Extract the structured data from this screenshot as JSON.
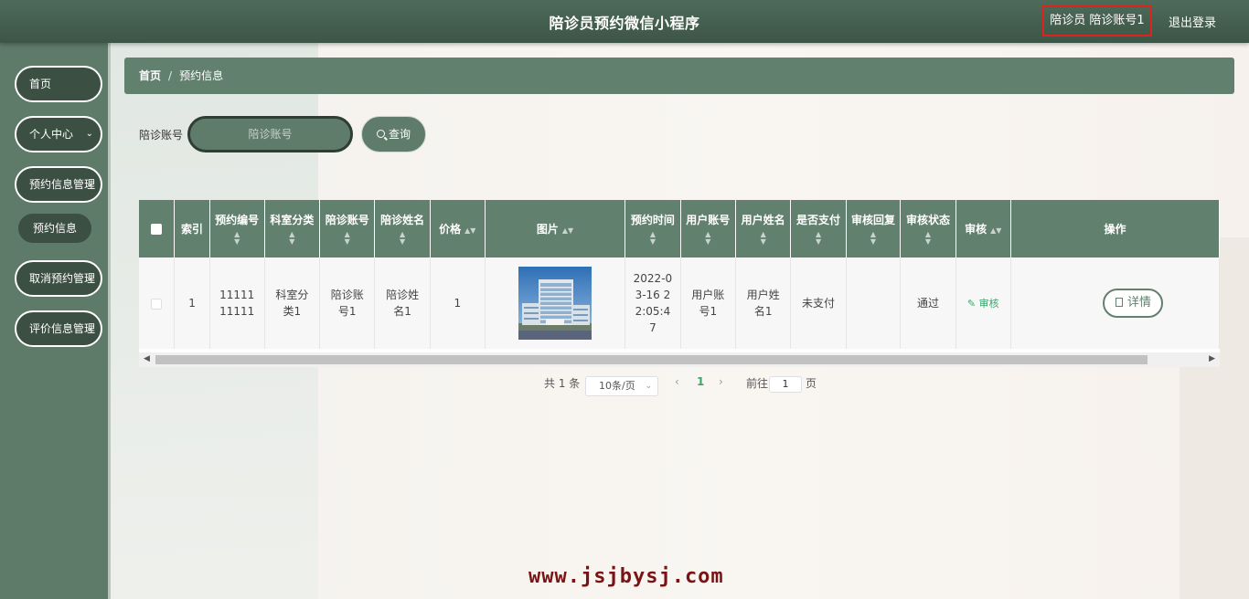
{
  "header": {
    "title": "陪诊员预约微信小程序",
    "user_label": "陪诊员 陪诊账号1",
    "logout_label": "退出登录"
  },
  "sidebar": {
    "items": [
      {
        "label": "首页"
      },
      {
        "label": "个人中心",
        "has_submenu": true
      },
      {
        "label": "预约信息管理",
        "has_submenu": true
      },
      {
        "label": "预约信息",
        "is_submenu": true
      },
      {
        "label": "取消预约管理",
        "has_submenu": true
      },
      {
        "label": "评价信息管理",
        "has_submenu": true
      }
    ]
  },
  "breadcrumb": {
    "home": "首页",
    "separator": "/",
    "current": "预约信息"
  },
  "search": {
    "label": "陪诊账号",
    "placeholder": "陪诊账号",
    "button_label": "查询"
  },
  "table": {
    "columns": [
      "索引",
      "预约编号",
      "科室分类",
      "陪诊账号",
      "陪诊姓名",
      "价格",
      "图片",
      "预约时间",
      "用户账号",
      "用户姓名",
      "是否支付",
      "审核回复",
      "审核状态",
      "审核",
      "操作"
    ],
    "rows": [
      {
        "index": "1",
        "booking_no": "1111111111",
        "department": "科室分类1",
        "escort_account": "陪诊账号1",
        "escort_name": "陪诊姓名1",
        "price": "1",
        "booking_time": "2022-03-16 22:05:47",
        "user_account": "用户账号1",
        "user_name": "用户姓名1",
        "paid": "未支付",
        "review_reply": "",
        "review_status": "通过",
        "review_action": "审核",
        "detail_action": "详情"
      }
    ]
  },
  "pagination": {
    "total_text": "共 1 条",
    "page_size": "10条/页",
    "current_page": "1",
    "goto_label": "前往",
    "goto_value": "1",
    "page_unit": "页"
  },
  "watermark": "www.jsjbysj.com",
  "colors": {
    "topbar": "#3d5546",
    "sidebar": "#5e7a69",
    "menu_button": "#3b4f42",
    "table_header": "#62806e",
    "highlight_box": "#e0221c",
    "watermark": "#7a1414"
  }
}
